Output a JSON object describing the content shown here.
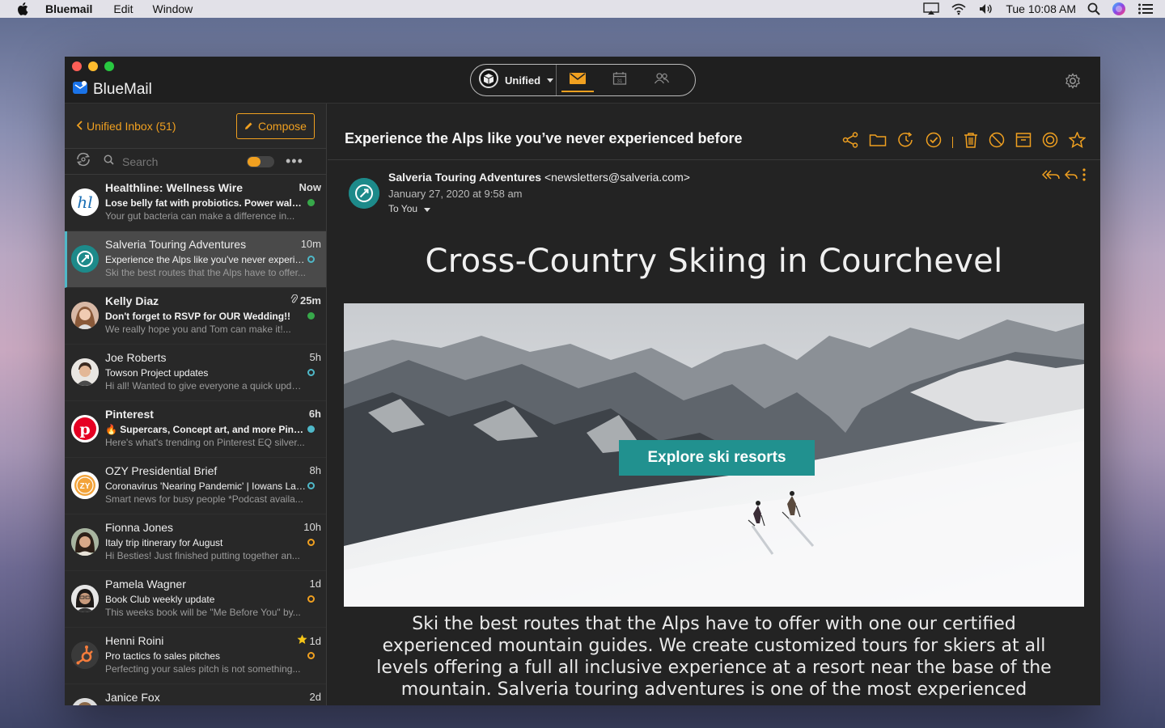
{
  "menubar": {
    "app_name": "Bluemail",
    "menus": [
      "Edit",
      "Window"
    ],
    "clock": "Tue 10:08 AM"
  },
  "window": {
    "brand": "BlueMail",
    "account_switch": "Unified",
    "tabs": [
      "mail",
      "calendar",
      "people"
    ],
    "active_tab": "mail"
  },
  "sidebar": {
    "back_label": "Unified Inbox (51)",
    "compose_label": "Compose",
    "search_placeholder": "Search"
  },
  "emails": [
    {
      "sender": "Healthline: Wellness Wire",
      "time": "Now",
      "subject": "Lose belly fat with probiotics. Power walking...",
      "preview": "Your gut bacteria can make a difference in...",
      "unread": true,
      "status": "filled-green",
      "avatar": "healthline-logo"
    },
    {
      "sender": "Salveria Touring Adventures",
      "time": "10m",
      "subject": "Experience the Alps like you've never experie...",
      "preview": "Ski the best routes that the Alps have to offer...",
      "unread": false,
      "status": "ring-blue",
      "avatar": "salveria-logo",
      "selected": true
    },
    {
      "sender": "Kelly Diaz",
      "time": "25m",
      "subject": "Don't forget to RSVP for OUR Wedding!!",
      "preview": "We really hope you and Tom can make it!...",
      "unread": true,
      "status": "filled-green",
      "avatar": "kelly-photo",
      "attachment": true
    },
    {
      "sender": "Joe Roberts",
      "time": "5h",
      "subject": "Towson Project updates",
      "preview": "Hi all! Wanted to give everyone a quick updat...",
      "unread": false,
      "status": "ring-blue",
      "avatar": "joe-photo"
    },
    {
      "sender": "Pinterest",
      "time": "6h",
      "subject": "🔥 Supercars, Concept art, and more Pins...",
      "preview": "Here's what's trending on Pinterest EQ silver...",
      "unread": true,
      "status": "filled-blue",
      "avatar": "pinterest-logo"
    },
    {
      "sender": "OZY Presidential Brief",
      "time": "8h",
      "subject": "Coronavirus 'Nearing Pandemic' | Iowans Lau...",
      "preview": "Smart news for busy people *Podcast availa...",
      "unread": false,
      "status": "ring-blue",
      "avatar": "ozy-logo"
    },
    {
      "sender": "Fionna Jones",
      "time": "10h",
      "subject": "Italy trip itinerary for August",
      "preview": "Hi Besties! Just finished putting together an...",
      "unread": false,
      "status": "ring-orange",
      "avatar": "fionna-photo"
    },
    {
      "sender": "Pamela Wagner",
      "time": "1d",
      "subject": "Book Club weekly update",
      "preview": "This weeks book will be \"Me Before You\" by...",
      "unread": false,
      "status": "ring-orange",
      "avatar": "pamela-photo"
    },
    {
      "sender": "Henni Roini",
      "time": "1d",
      "subject": "Pro tactics fo sales pitches",
      "preview": "Perfecting your sales pitch is not something...",
      "unread": false,
      "status": "ring-orange",
      "avatar": "hubspot-logo",
      "starred": true
    },
    {
      "sender": "Janice Fox",
      "time": "2d",
      "subject": "",
      "preview": "",
      "unread": false,
      "status": "",
      "avatar": "janice-photo"
    }
  ],
  "message": {
    "title": "Experience the Alps like you’ve never experienced before",
    "from_name": "Salveria Touring Adventures",
    "from_email": "<newsletters@salveria.com>",
    "date": "January 27, 2020 at 9:58 am",
    "to": "To You",
    "heading": "Cross-Country Skiing in Courchevel",
    "cta": "Explore ski resorts",
    "body": "Ski the best routes that the Alps have to offer with one our certified experienced mountain guides. We create customized tours for skiers at all levels offering a full all inclusive experience at a resort near the base of the mountain. Salveria touring adventures is one of the most experienced"
  },
  "colors": {
    "accent": "#f0a020",
    "teal": "#21918f",
    "unread_green": "#37a84a",
    "ring_blue": "#4fb8c8"
  }
}
